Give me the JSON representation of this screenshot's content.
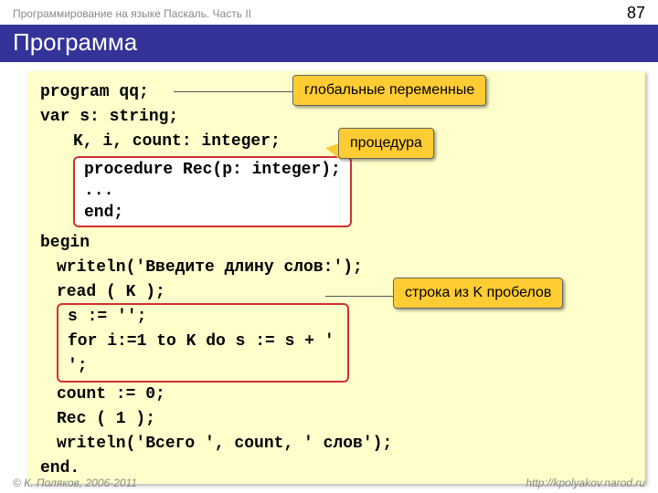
{
  "header": {
    "course": "Программирование на языке Паскаль. Часть II",
    "page": "87"
  },
  "title": "Программа",
  "code": {
    "l1": "program qq;",
    "l2": "var s: string;",
    "l3": "K, i, count: integer;",
    "proc1": "procedure Rec(p: integer);",
    "proc2": "...",
    "proc3": "end;",
    "l4": "begin",
    "l5": "writeln('Введите длину слов:');",
    "l6": "read ( K );",
    "b1": "s := '';",
    "b2": "for i:=1 to K do s := s + ' ';",
    "l7": "count := 0;",
    "l8": "Rec ( 1 );",
    "l9": "writeln('Всего ', count, ' слов');",
    "l10": "end."
  },
  "callouts": {
    "c1": "глобальные переменные",
    "c2": "процедура",
    "c3": "строка из K пробелов"
  },
  "footer": {
    "left": "© К. Поляков, 2006-2011",
    "right": "http://kpolyakov.narod.ru"
  }
}
